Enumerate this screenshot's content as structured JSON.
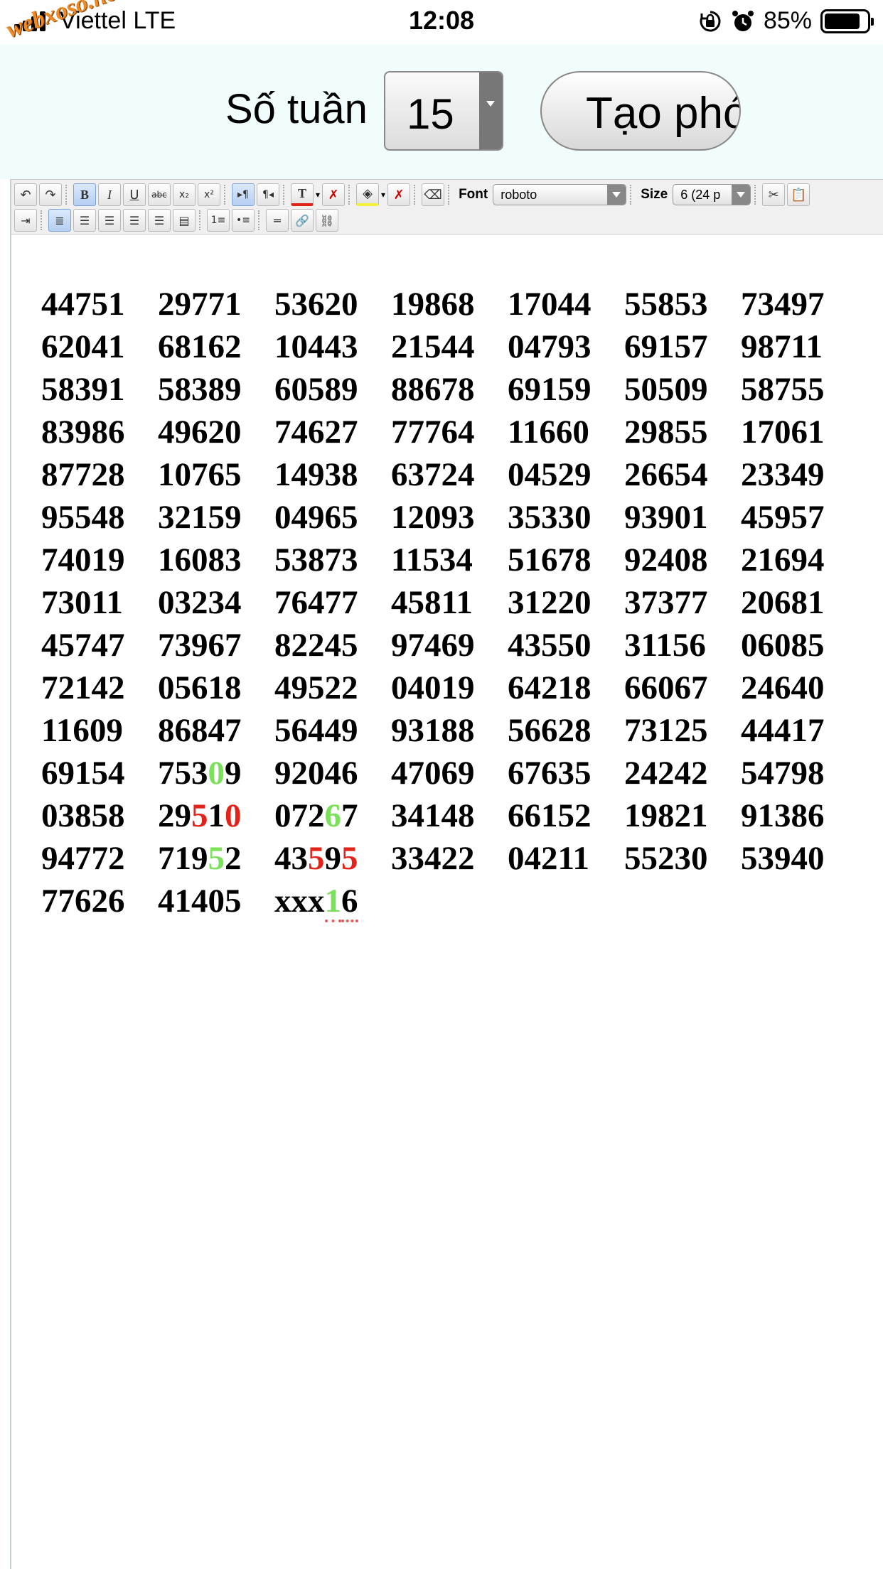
{
  "status_bar": {
    "carrier": "Viettel LTE",
    "time": "12:08",
    "battery": "85%",
    "battery_level": 0.85
  },
  "watermark": "webxoso.net",
  "controls": {
    "week_label": "Số tuần",
    "week_value": "15",
    "create_button": "Tạo phó"
  },
  "toolbar": {
    "font_label": "Font",
    "font_value": "roboto",
    "size_label": "Size",
    "size_value": "6 (24 p"
  },
  "icons": {
    "undo": "undo-icon",
    "redo": "redo-icon",
    "bold": "bold-icon",
    "italic": "italic-icon",
    "underline": "underline-icon",
    "strike": "strikethrough-icon",
    "sub": "subscript-icon",
    "sup": "superscript-icon",
    "ltr": "ltr-icon",
    "rtl": "rtl-icon",
    "text_color": "text-color-icon",
    "remove_color": "remove-color-icon",
    "bg_color": "background-color-icon",
    "remove_bg": "remove-background-icon",
    "eraser": "eraser-icon",
    "cut": "cut-icon",
    "paste": "paste-icon",
    "indent": "indent-icon",
    "align_left": "align-left-icon",
    "align_center": "align-center-icon",
    "align_right": "align-right-icon",
    "justify": "justify-icon",
    "ordered_list": "ordered-list-icon",
    "unordered_list": "unordered-list-icon",
    "hr": "horizontal-rule-icon",
    "link": "link-icon",
    "unlink": "unlink-icon"
  },
  "colors": {
    "red": "#e2231a",
    "green": "#7be05a",
    "panel_bg": "#f1fdfd"
  },
  "numbers": [
    [
      [
        {
          "t": "44751"
        }
      ],
      [
        {
          "t": "29771"
        }
      ],
      [
        {
          "t": "53620"
        }
      ],
      [
        {
          "t": "19868"
        }
      ],
      [
        {
          "t": "17044"
        }
      ],
      [
        {
          "t": "55853"
        }
      ],
      [
        {
          "t": "73497"
        }
      ]
    ],
    [
      [
        {
          "t": "62041"
        }
      ],
      [
        {
          "t": "68162"
        }
      ],
      [
        {
          "t": "10443"
        }
      ],
      [
        {
          "t": "21544"
        }
      ],
      [
        {
          "t": "04793"
        }
      ],
      [
        {
          "t": "69157"
        }
      ],
      [
        {
          "t": "98711"
        }
      ]
    ],
    [
      [
        {
          "t": "58391"
        }
      ],
      [
        {
          "t": "58389"
        }
      ],
      [
        {
          "t": "60589"
        }
      ],
      [
        {
          "t": "88678"
        }
      ],
      [
        {
          "t": "69159"
        }
      ],
      [
        {
          "t": "50509"
        }
      ],
      [
        {
          "t": "58755"
        }
      ]
    ],
    [
      [
        {
          "t": "83986"
        }
      ],
      [
        {
          "t": "49620"
        }
      ],
      [
        {
          "t": "74627"
        }
      ],
      [
        {
          "t": "77764"
        }
      ],
      [
        {
          "t": "11660"
        }
      ],
      [
        {
          "t": "29855"
        }
      ],
      [
        {
          "t": "17061"
        }
      ]
    ],
    [
      [
        {
          "t": "87728"
        }
      ],
      [
        {
          "t": "10765"
        }
      ],
      [
        {
          "t": "14938"
        }
      ],
      [
        {
          "t": "63724"
        }
      ],
      [
        {
          "t": "04529"
        }
      ],
      [
        {
          "t": "26654"
        }
      ],
      [
        {
          "t": "23349"
        }
      ]
    ],
    [
      [
        {
          "t": "95548"
        }
      ],
      [
        {
          "t": "32159"
        }
      ],
      [
        {
          "t": "04965"
        }
      ],
      [
        {
          "t": "12093"
        }
      ],
      [
        {
          "t": "35330"
        }
      ],
      [
        {
          "t": "93901"
        }
      ],
      [
        {
          "t": "45957"
        }
      ]
    ],
    [
      [
        {
          "t": "74019"
        }
      ],
      [
        {
          "t": "16083"
        }
      ],
      [
        {
          "t": "53873"
        }
      ],
      [
        {
          "t": "11534"
        }
      ],
      [
        {
          "t": "51678"
        }
      ],
      [
        {
          "t": "92408"
        }
      ],
      [
        {
          "t": "21694"
        }
      ]
    ],
    [
      [
        {
          "t": "73011"
        }
      ],
      [
        {
          "t": "03234"
        }
      ],
      [
        {
          "t": "76477"
        }
      ],
      [
        {
          "t": "45811"
        }
      ],
      [
        {
          "t": "31220"
        }
      ],
      [
        {
          "t": "37377"
        }
      ],
      [
        {
          "t": "20681"
        }
      ]
    ],
    [
      [
        {
          "t": "45747"
        }
      ],
      [
        {
          "t": "73967"
        }
      ],
      [
        {
          "t": "82245"
        }
      ],
      [
        {
          "t": "97469"
        }
      ],
      [
        {
          "t": "43550"
        }
      ],
      [
        {
          "t": "31156"
        }
      ],
      [
        {
          "t": "06085"
        }
      ]
    ],
    [
      [
        {
          "t": "72142"
        }
      ],
      [
        {
          "t": "05618"
        }
      ],
      [
        {
          "t": "49522"
        }
      ],
      [
        {
          "t": "04019"
        }
      ],
      [
        {
          "t": "64218"
        }
      ],
      [
        {
          "t": "66067"
        }
      ],
      [
        {
          "t": "24640"
        }
      ]
    ],
    [
      [
        {
          "t": "11609"
        }
      ],
      [
        {
          "t": "86847"
        }
      ],
      [
        {
          "t": "56449"
        }
      ],
      [
        {
          "t": "93188"
        }
      ],
      [
        {
          "t": "56628"
        }
      ],
      [
        {
          "t": "73125"
        }
      ],
      [
        {
          "t": "44417"
        }
      ]
    ],
    [
      [
        {
          "t": "69154"
        }
      ],
      [
        {
          "t": "753"
        },
        {
          "t": "0",
          "c": "green"
        },
        {
          "t": "9"
        }
      ],
      [
        {
          "t": "92046"
        }
      ],
      [
        {
          "t": "47069"
        }
      ],
      [
        {
          "t": "67635"
        }
      ],
      [
        {
          "t": "24242"
        }
      ],
      [
        {
          "t": "54798"
        }
      ]
    ],
    [
      [
        {
          "t": "03858"
        }
      ],
      [
        {
          "t": "29"
        },
        {
          "t": "5",
          "c": "red"
        },
        {
          "t": "1"
        },
        {
          "t": "0",
          "c": "red"
        }
      ],
      [
        {
          "t": "072"
        },
        {
          "t": "6",
          "c": "green"
        },
        {
          "t": "7"
        }
      ],
      [
        {
          "t": "34148"
        }
      ],
      [
        {
          "t": "66152"
        }
      ],
      [
        {
          "t": "19821"
        }
      ],
      [
        {
          "t": "91386"
        }
      ]
    ],
    [
      [
        {
          "t": "94772"
        }
      ],
      [
        {
          "t": "719"
        },
        {
          "t": "5",
          "c": "green"
        },
        {
          "t": "2"
        }
      ],
      [
        {
          "t": "43"
        },
        {
          "t": "5",
          "c": "red"
        },
        {
          "t": "9"
        },
        {
          "t": "5",
          "c": "red"
        }
      ],
      [
        {
          "t": "33422"
        }
      ],
      [
        {
          "t": "04211"
        }
      ],
      [
        {
          "t": "55230"
        }
      ],
      [
        {
          "t": "53940"
        }
      ]
    ],
    [
      [
        {
          "t": "77626"
        }
      ],
      [
        {
          "t": "41405"
        }
      ],
      [
        {
          "t": "xxx"
        },
        {
          "t": "1",
          "c": "green",
          "d": true
        },
        {
          "t": "6",
          "d": true
        }
      ]
    ]
  ]
}
